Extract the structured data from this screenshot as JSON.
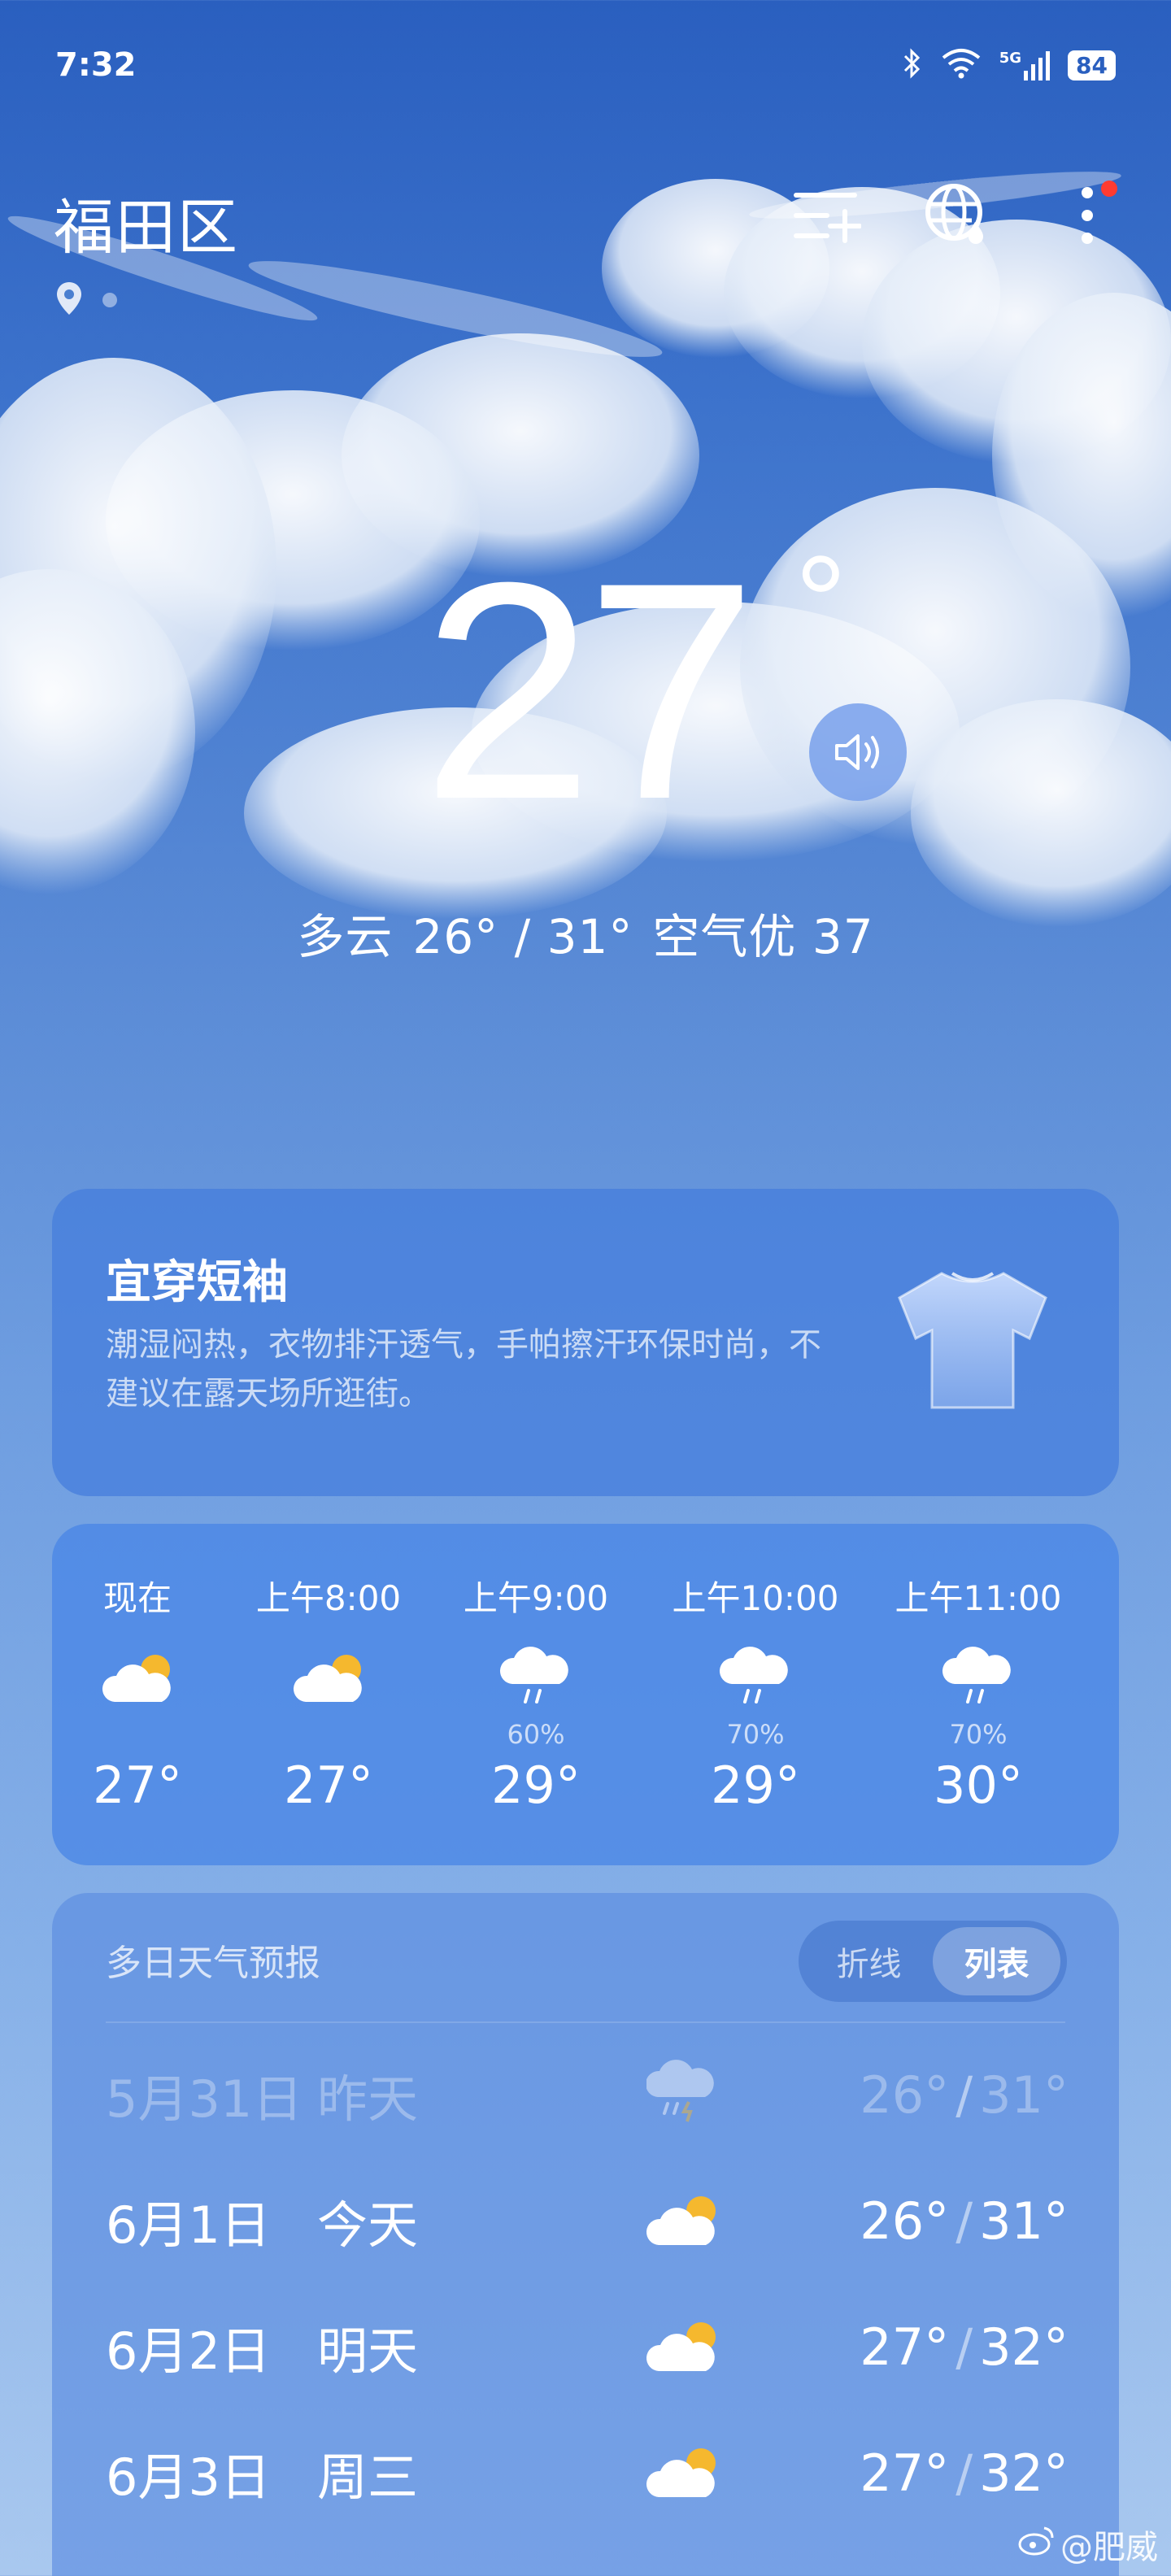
{
  "status_bar": {
    "time": "7:32",
    "network": "5G",
    "battery": "84"
  },
  "header": {
    "city": "福田区"
  },
  "current": {
    "temp": "27",
    "degree_symbol": "°",
    "summary_condition": "多云",
    "summary_range": "26° / 31°",
    "summary_air": "空气优 37"
  },
  "clothing": {
    "title": "宜穿短袖",
    "description": "潮湿闷热，衣物排汗透气，手帕擦汗环保时尚，不建议在露天场所逛街。"
  },
  "hourly": [
    {
      "time": "现在",
      "icon": "partly-cloudy-icon",
      "pct": "",
      "temp": "27°"
    },
    {
      "time": "上午8:00",
      "icon": "partly-cloudy-icon",
      "pct": "",
      "temp": "27°"
    },
    {
      "time": "上午9:00",
      "icon": "rain-icon",
      "pct": "60%",
      "temp": "29°"
    },
    {
      "time": "上午10:00",
      "icon": "rain-icon",
      "pct": "70%",
      "temp": "29°"
    },
    {
      "time": "上午11:00",
      "icon": "rain-icon",
      "pct": "70%",
      "temp": "30°"
    }
  ],
  "daily": {
    "title": "多日天气预报",
    "toggle_line": "折线",
    "toggle_list": "列表",
    "rows": [
      {
        "date": "5月31日",
        "day": "昨天",
        "icon": "thunderstorm-icon",
        "low": "26°",
        "high": "31°"
      },
      {
        "date": "6月1日",
        "day": "今天",
        "icon": "partly-cloudy-icon",
        "low": "26°",
        "high": "31°"
      },
      {
        "date": "6月2日",
        "day": "明天",
        "icon": "partly-cloudy-icon",
        "low": "27°",
        "high": "32°"
      },
      {
        "date": "6月3日",
        "day": "周三",
        "icon": "partly-cloudy-icon",
        "low": "27°",
        "high": "32°"
      }
    ]
  },
  "watermark": "@肥威",
  "colors": {
    "sky_top": "#2a5fbf",
    "sun": "#f5b82e",
    "alert": "#ff3b30"
  }
}
